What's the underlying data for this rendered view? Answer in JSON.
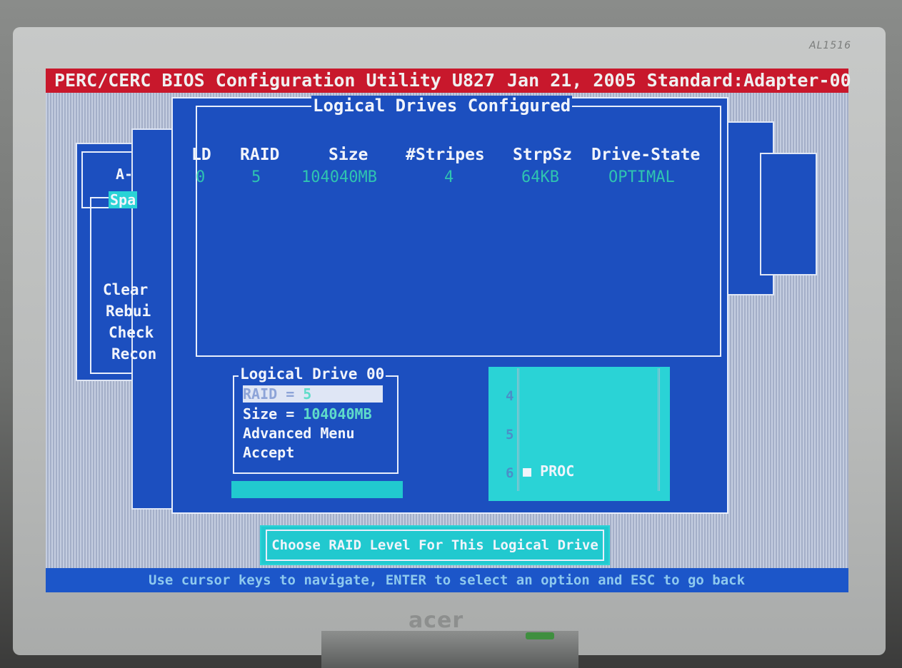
{
  "monitor": {
    "model_label": "AL1516",
    "brand": "acer"
  },
  "title_bar": {
    "left": "PERC/CERC BIOS Configuration Utility U827",
    "right": "Jan 21, 2005 Standard:Adapter-00"
  },
  "background_menu": {
    "items": [
      "Clear",
      "Rebui",
      "Check",
      "Recon"
    ],
    "sub_title": "A-",
    "sub_selected": "Spa"
  },
  "logical_drives": {
    "title": "Logical Drives Configured",
    "columns": [
      "LD",
      "RAID",
      "Size",
      "#Stripes",
      "StrpSz",
      "Drive-State"
    ],
    "rows": [
      [
        "0",
        "5",
        "104040MB",
        "4",
        "64KB",
        "OPTIMAL"
      ]
    ]
  },
  "logical_drive_menu": {
    "title": "Logical Drive 00",
    "raid_label": "RAID = ",
    "raid_value": "5",
    "size_label": "Size = ",
    "size_value": "104040MB",
    "advanced": "Advanced Menu",
    "accept": "Accept"
  },
  "span_panel": {
    "numbers": [
      "4",
      "5",
      "6"
    ],
    "proc": "PROC"
  },
  "help": "Choose RAID Level For This Logical Drive",
  "status_bar": "Use cursor keys to navigate, ENTER to select an option and ESC to go back",
  "colors": {
    "title_bar": "#c8182c",
    "panel_blue": "#1c4fbf",
    "cyan": "#2ad3d6",
    "text_cyan": "#2fc4b0"
  }
}
